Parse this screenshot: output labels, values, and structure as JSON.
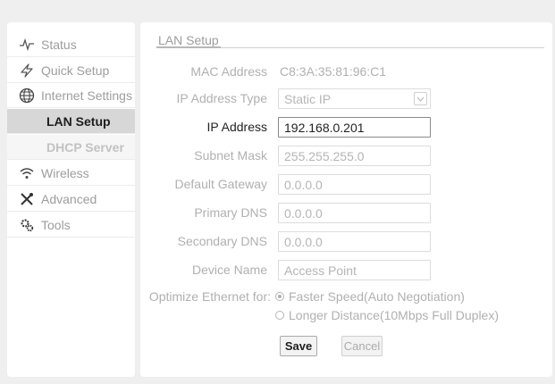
{
  "sidebar": {
    "items": [
      {
        "label": "Status",
        "icon": "pulse-icon"
      },
      {
        "label": "Quick Setup",
        "icon": "lightning-icon"
      },
      {
        "label": "Internet Settings",
        "icon": "globe-icon"
      },
      {
        "label": "LAN Setup",
        "active": true
      },
      {
        "label": "DHCP Server"
      },
      {
        "label": "Wireless",
        "icon": "wifi-icon"
      },
      {
        "label": "Advanced",
        "icon": "wrench-screwdriver-icon"
      },
      {
        "label": "Tools",
        "icon": "gears-icon"
      }
    ]
  },
  "main": {
    "section_title": "LAN Setup",
    "mac_label": "MAC Address",
    "mac_value": "C8:3A:35:81:96:C1",
    "ip_type_label": "IP Address Type",
    "ip_type_value": "Static IP",
    "ip_label": "IP Address",
    "ip_value": "192.168.0.201",
    "subnet_label": "Subnet Mask",
    "subnet_value": "255.255.255.0",
    "gateway_label": "Default Gateway",
    "gateway_value": "0.0.0.0",
    "pdns_label": "Primary DNS",
    "pdns_value": "0.0.0.0",
    "sdns_label": "Secondary DNS",
    "sdns_value": "0.0.0.0",
    "device_label": "Device Name",
    "device_value": "Access Point",
    "optimize_label": "Optimize Ethernet for:",
    "opt1": "Faster Speed(Auto Negotiation)",
    "opt2": "Longer Distance(10Mbps Full Duplex)",
    "save_label": "Save",
    "cancel_label": "Cancel"
  }
}
